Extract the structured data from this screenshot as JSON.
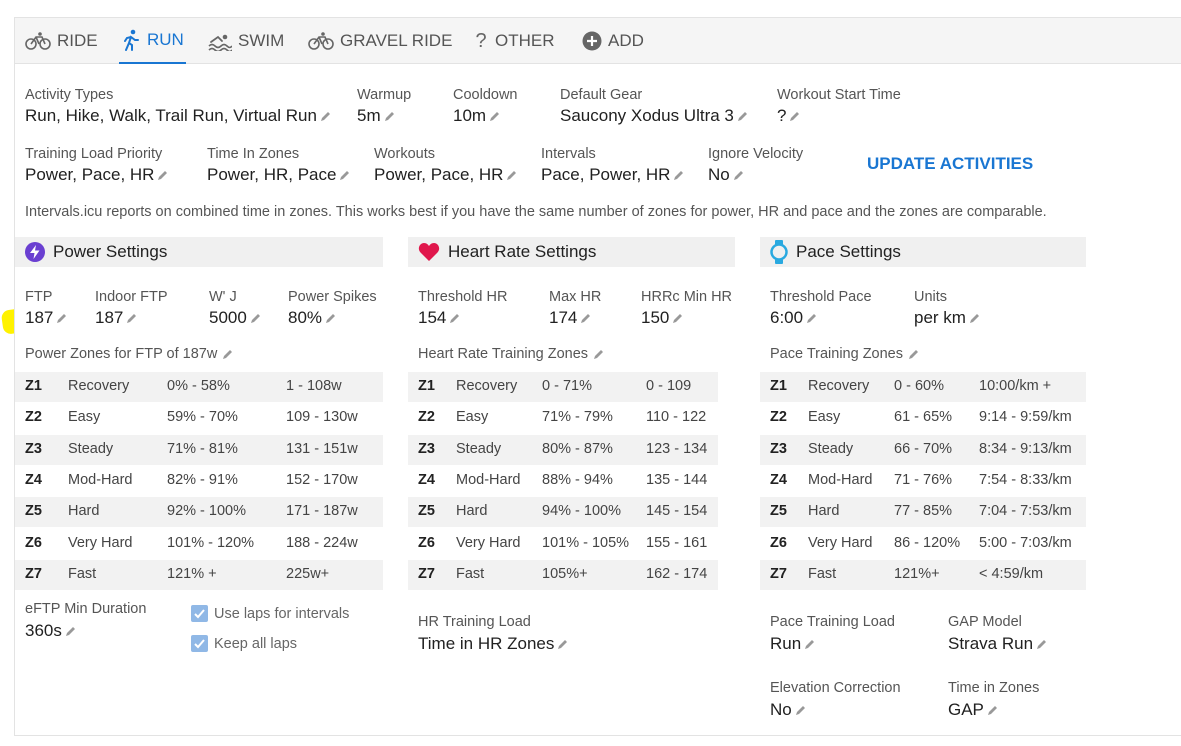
{
  "tabs": [
    {
      "label": "RIDE",
      "icon": "bike-icon",
      "active": false
    },
    {
      "label": "RUN",
      "icon": "run-icon",
      "active": true
    },
    {
      "label": "SWIM",
      "icon": "swim-icon",
      "active": false
    },
    {
      "label": "GRAVEL RIDE",
      "icon": "bike-icon",
      "active": false
    },
    {
      "label": "OTHER",
      "icon": "question-icon",
      "active": false
    },
    {
      "label": "ADD",
      "icon": "add-circle-icon",
      "active": false
    }
  ],
  "settings_row1": [
    {
      "label": "Activity Types",
      "value": "Run, Hike, Walk, Trail Run, Virtual Run"
    },
    {
      "label": "Warmup",
      "value": "5m"
    },
    {
      "label": "Cooldown",
      "value": "10m"
    },
    {
      "label": "Default Gear",
      "value": "Saucony Xodus Ultra 3"
    },
    {
      "label": "Workout Start Time",
      "value": "?"
    }
  ],
  "settings_row2": [
    {
      "label": "Training Load Priority",
      "value": "Power, Pace, HR"
    },
    {
      "label": "Time In Zones",
      "value": "Power, HR, Pace"
    },
    {
      "label": "Workouts",
      "value": "Power, Pace, HR"
    },
    {
      "label": "Intervals",
      "value": "Pace, Power, HR"
    },
    {
      "label": "Ignore Velocity",
      "value": "No"
    }
  ],
  "update_activities_label": "UPDATE ACTIVITIES",
  "zones_note": "Intervals.icu reports on combined time in zones. This works best if you have the same number of zones for power, HR and pace and the zones are comparable.",
  "power": {
    "title": "Power Settings",
    "fields": [
      {
        "label": "FTP",
        "value": "187"
      },
      {
        "label": "Indoor FTP",
        "value": "187"
      },
      {
        "label": "W' J",
        "value": "5000"
      },
      {
        "label": "Power Spikes",
        "value": "80%"
      }
    ],
    "zones_title": "Power Zones for FTP of 187w",
    "zones": [
      {
        "id": "Z1",
        "name": "Recovery",
        "pct": "0% - 58%",
        "range": "1 - 108w"
      },
      {
        "id": "Z2",
        "name": "Easy",
        "pct": "59% - 70%",
        "range": "109 - 130w"
      },
      {
        "id": "Z3",
        "name": "Steady",
        "pct": "71% - 81%",
        "range": "131 - 151w"
      },
      {
        "id": "Z4",
        "name": "Mod-Hard",
        "pct": "82% - 91%",
        "range": "152 - 170w"
      },
      {
        "id": "Z5",
        "name": "Hard",
        "pct": "92% - 100%",
        "range": "171 - 187w"
      },
      {
        "id": "Z6",
        "name": "Very Hard",
        "pct": "101% - 120%",
        "range": "188 - 224w"
      },
      {
        "id": "Z7",
        "name": "Fast",
        "pct": "121% +",
        "range": "225w+"
      }
    ],
    "eftp_label": "eFTP Min Duration",
    "eftp_value": "360s",
    "checkboxes": [
      {
        "label": "Use laps for intervals",
        "checked": true
      },
      {
        "label": "Keep all laps",
        "checked": true
      }
    ]
  },
  "hr": {
    "title": "Heart Rate Settings",
    "fields": [
      {
        "label": "Threshold HR",
        "value": "154"
      },
      {
        "label": "Max HR",
        "value": "174"
      },
      {
        "label": "HRRc Min HR",
        "value": "150"
      }
    ],
    "zones_title": "Heart Rate Training Zones",
    "zones": [
      {
        "id": "Z1",
        "name": "Recovery",
        "pct": "0 - 71%",
        "range": "0 - 109"
      },
      {
        "id": "Z2",
        "name": "Easy",
        "pct": "71% - 79%",
        "range": "110 - 122"
      },
      {
        "id": "Z3",
        "name": "Steady",
        "pct": "80% - 87%",
        "range": "123 - 134"
      },
      {
        "id": "Z4",
        "name": "Mod-Hard",
        "pct": "88% - 94%",
        "range": "135 - 144"
      },
      {
        "id": "Z5",
        "name": "Hard",
        "pct": "94% - 100%",
        "range": "145 - 154"
      },
      {
        "id": "Z6",
        "name": "Very Hard",
        "pct": "101% - 105%",
        "range": "155 - 161"
      },
      {
        "id": "Z7",
        "name": "Fast",
        "pct": "105%+",
        "range": "162 - 174"
      }
    ],
    "load_label": "HR Training Load",
    "load_value": "Time in HR Zones"
  },
  "pace": {
    "title": "Pace Settings",
    "fields": [
      {
        "label": "Threshold Pace",
        "value": "6:00"
      },
      {
        "label": "Units",
        "value": "per km"
      }
    ],
    "zones_title": "Pace Training Zones",
    "zones": [
      {
        "id": "Z1",
        "name": "Recovery",
        "pct": "0 - 60%",
        "range": "10:00/km +"
      },
      {
        "id": "Z2",
        "name": "Easy",
        "pct": "61 - 65%",
        "range": "9:14 - 9:59/km"
      },
      {
        "id": "Z3",
        "name": "Steady",
        "pct": "66 - 70%",
        "range": "8:34 - 9:13/km"
      },
      {
        "id": "Z4",
        "name": "Mod-Hard",
        "pct": "71 - 76%",
        "range": "7:54 - 8:33/km"
      },
      {
        "id": "Z5",
        "name": "Hard",
        "pct": "77 - 85%",
        "range": "7:04 - 7:53/km"
      },
      {
        "id": "Z6",
        "name": "Very Hard",
        "pct": "86 - 120%",
        "range": "5:00 - 7:03/km"
      },
      {
        "id": "Z7",
        "name": "Fast",
        "pct": "121%+",
        "range": "< 4:59/km"
      }
    ],
    "load_label": "Pace Training Load",
    "load_value": "Run",
    "gap_label": "GAP Model",
    "gap_value": "Strava Run",
    "elev_label": "Elevation Correction",
    "elev_value": "No",
    "tiz_label": "Time in Zones",
    "tiz_value": "GAP"
  },
  "colors": {
    "accent": "#1976d2",
    "power_icon": "#6a3fd1",
    "heart_icon": "#e0174c",
    "pace_icon": "#29a9e0",
    "highlight": "#fff200"
  }
}
